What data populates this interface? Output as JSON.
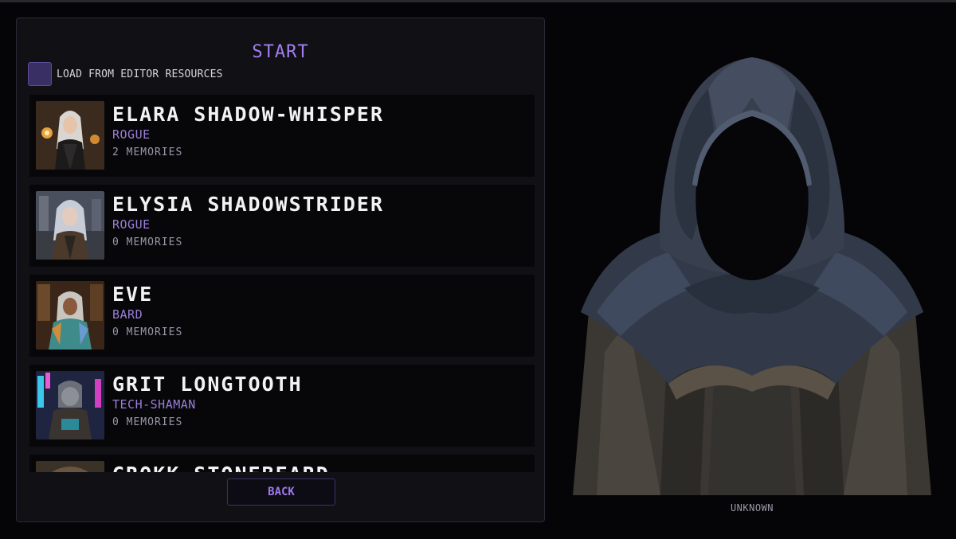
{
  "menu": {
    "title": "START",
    "load_option_label": "LOAD FROM EDITOR RESOURCES",
    "back_label": "BACK"
  },
  "characters": [
    {
      "name": "ELARA SHADOW-WHISPER",
      "class": "ROGUE",
      "memories": "2 MEMORIES"
    },
    {
      "name": "ELYSIA SHADOWSTRIDER",
      "class": "ROGUE",
      "memories": "0 MEMORIES"
    },
    {
      "name": "EVE",
      "class": "BARD",
      "memories": "0 MEMORIES"
    },
    {
      "name": "GRIT LONGTOOTH",
      "class": "TECH-SHAMAN",
      "memories": "0 MEMORIES"
    },
    {
      "name": "GROKK STONEBEARD",
      "class": "",
      "memories": ""
    }
  ],
  "preview": {
    "caption": "UNKNOWN",
    "image_icon": "hooded-figure-icon"
  },
  "colors": {
    "accent": "#a37ef0",
    "panel_bg": "#111015",
    "card_bg": "#07070a",
    "class_text": "#9a7ed6"
  }
}
